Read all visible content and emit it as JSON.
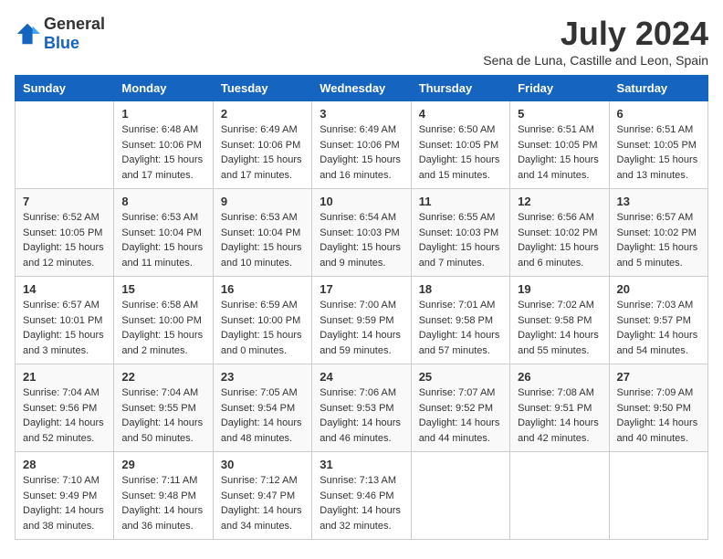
{
  "logo": {
    "general": "General",
    "blue": "Blue"
  },
  "title": "July 2024",
  "subtitle": "Sena de Luna, Castille and Leon, Spain",
  "headers": [
    "Sunday",
    "Monday",
    "Tuesday",
    "Wednesday",
    "Thursday",
    "Friday",
    "Saturday"
  ],
  "weeks": [
    [
      {
        "day": "",
        "info": ""
      },
      {
        "day": "1",
        "info": "Sunrise: 6:48 AM\nSunset: 10:06 PM\nDaylight: 15 hours\nand 17 minutes."
      },
      {
        "day": "2",
        "info": "Sunrise: 6:49 AM\nSunset: 10:06 PM\nDaylight: 15 hours\nand 17 minutes."
      },
      {
        "day": "3",
        "info": "Sunrise: 6:49 AM\nSunset: 10:06 PM\nDaylight: 15 hours\nand 16 minutes."
      },
      {
        "day": "4",
        "info": "Sunrise: 6:50 AM\nSunset: 10:05 PM\nDaylight: 15 hours\nand 15 minutes."
      },
      {
        "day": "5",
        "info": "Sunrise: 6:51 AM\nSunset: 10:05 PM\nDaylight: 15 hours\nand 14 minutes."
      },
      {
        "day": "6",
        "info": "Sunrise: 6:51 AM\nSunset: 10:05 PM\nDaylight: 15 hours\nand 13 minutes."
      }
    ],
    [
      {
        "day": "7",
        "info": "Sunrise: 6:52 AM\nSunset: 10:05 PM\nDaylight: 15 hours\nand 12 minutes."
      },
      {
        "day": "8",
        "info": "Sunrise: 6:53 AM\nSunset: 10:04 PM\nDaylight: 15 hours\nand 11 minutes."
      },
      {
        "day": "9",
        "info": "Sunrise: 6:53 AM\nSunset: 10:04 PM\nDaylight: 15 hours\nand 10 minutes."
      },
      {
        "day": "10",
        "info": "Sunrise: 6:54 AM\nSunset: 10:03 PM\nDaylight: 15 hours\nand 9 minutes."
      },
      {
        "day": "11",
        "info": "Sunrise: 6:55 AM\nSunset: 10:03 PM\nDaylight: 15 hours\nand 7 minutes."
      },
      {
        "day": "12",
        "info": "Sunrise: 6:56 AM\nSunset: 10:02 PM\nDaylight: 15 hours\nand 6 minutes."
      },
      {
        "day": "13",
        "info": "Sunrise: 6:57 AM\nSunset: 10:02 PM\nDaylight: 15 hours\nand 5 minutes."
      }
    ],
    [
      {
        "day": "14",
        "info": "Sunrise: 6:57 AM\nSunset: 10:01 PM\nDaylight: 15 hours\nand 3 minutes."
      },
      {
        "day": "15",
        "info": "Sunrise: 6:58 AM\nSunset: 10:00 PM\nDaylight: 15 hours\nand 2 minutes."
      },
      {
        "day": "16",
        "info": "Sunrise: 6:59 AM\nSunset: 10:00 PM\nDaylight: 15 hours\nand 0 minutes."
      },
      {
        "day": "17",
        "info": "Sunrise: 7:00 AM\nSunset: 9:59 PM\nDaylight: 14 hours\nand 59 minutes."
      },
      {
        "day": "18",
        "info": "Sunrise: 7:01 AM\nSunset: 9:58 PM\nDaylight: 14 hours\nand 57 minutes."
      },
      {
        "day": "19",
        "info": "Sunrise: 7:02 AM\nSunset: 9:58 PM\nDaylight: 14 hours\nand 55 minutes."
      },
      {
        "day": "20",
        "info": "Sunrise: 7:03 AM\nSunset: 9:57 PM\nDaylight: 14 hours\nand 54 minutes."
      }
    ],
    [
      {
        "day": "21",
        "info": "Sunrise: 7:04 AM\nSunset: 9:56 PM\nDaylight: 14 hours\nand 52 minutes."
      },
      {
        "day": "22",
        "info": "Sunrise: 7:04 AM\nSunset: 9:55 PM\nDaylight: 14 hours\nand 50 minutes."
      },
      {
        "day": "23",
        "info": "Sunrise: 7:05 AM\nSunset: 9:54 PM\nDaylight: 14 hours\nand 48 minutes."
      },
      {
        "day": "24",
        "info": "Sunrise: 7:06 AM\nSunset: 9:53 PM\nDaylight: 14 hours\nand 46 minutes."
      },
      {
        "day": "25",
        "info": "Sunrise: 7:07 AM\nSunset: 9:52 PM\nDaylight: 14 hours\nand 44 minutes."
      },
      {
        "day": "26",
        "info": "Sunrise: 7:08 AM\nSunset: 9:51 PM\nDaylight: 14 hours\nand 42 minutes."
      },
      {
        "day": "27",
        "info": "Sunrise: 7:09 AM\nSunset: 9:50 PM\nDaylight: 14 hours\nand 40 minutes."
      }
    ],
    [
      {
        "day": "28",
        "info": "Sunrise: 7:10 AM\nSunset: 9:49 PM\nDaylight: 14 hours\nand 38 minutes."
      },
      {
        "day": "29",
        "info": "Sunrise: 7:11 AM\nSunset: 9:48 PM\nDaylight: 14 hours\nand 36 minutes."
      },
      {
        "day": "30",
        "info": "Sunrise: 7:12 AM\nSunset: 9:47 PM\nDaylight: 14 hours\nand 34 minutes."
      },
      {
        "day": "31",
        "info": "Sunrise: 7:13 AM\nSunset: 9:46 PM\nDaylight: 14 hours\nand 32 minutes."
      },
      {
        "day": "",
        "info": ""
      },
      {
        "day": "",
        "info": ""
      },
      {
        "day": "",
        "info": ""
      }
    ]
  ]
}
